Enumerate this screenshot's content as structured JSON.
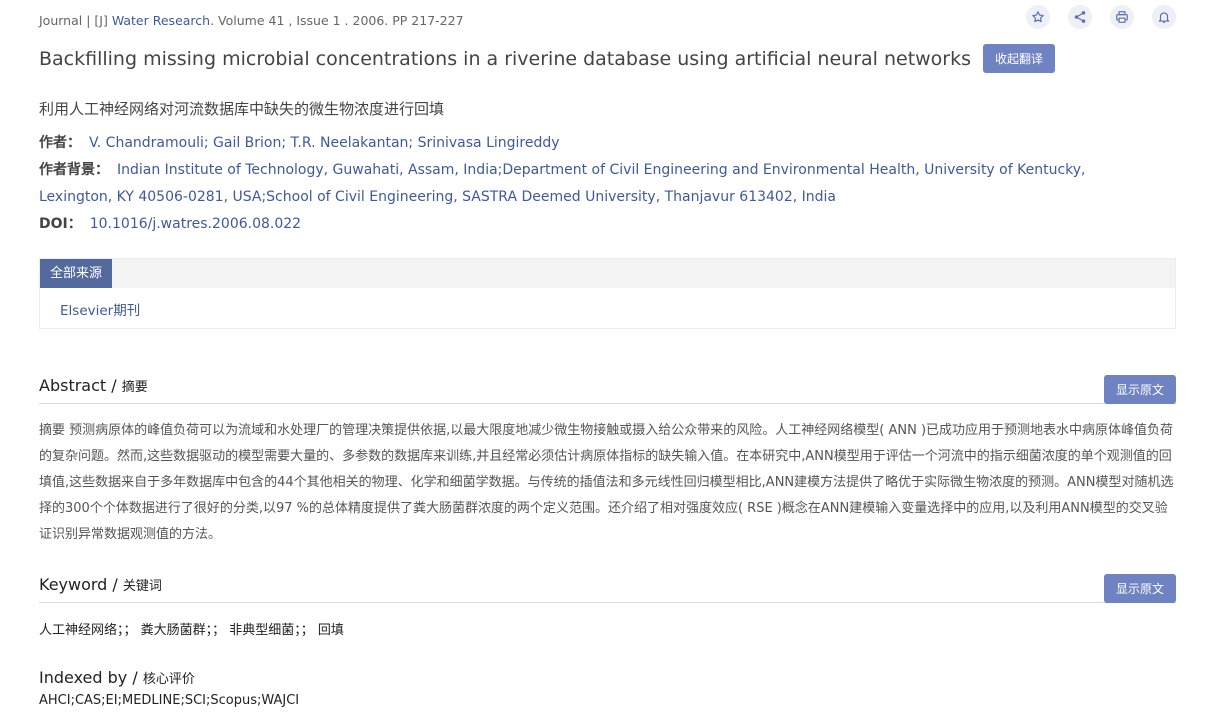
{
  "meta": {
    "prefix": "Journal | [J] ",
    "journal": "Water Research",
    "suffix": ". Volume 41 , Issue 1 . 2006. PP 217-227"
  },
  "actions": {
    "favorite_icon": "star-icon",
    "share_icon": "share-icon",
    "print_icon": "print-icon",
    "notify_icon": "bell-icon"
  },
  "title": "Backfilling missing microbial concentrations in a riverine database using artificial neural networks",
  "translate_button": "收起翻译",
  "cn_title": "利用人工神经网络对河流数据库中缺失的微生物浓度进行回填",
  "authors": {
    "label": "作者：",
    "value": "V. Chandramouli; Gail Brion; T.R. Neelakantan; Srinivasa Lingireddy"
  },
  "affiliation": {
    "label": "作者背景：",
    "value": "Indian Institute of Technology, Guwahati, Assam, India;Department of Civil Engineering and Environmental Health, University of Kentucky, Lexington, KY 40506-0281, USA;School of Civil Engineering, SASTRA Deemed University, Thanjavur 613402, India"
  },
  "doi": {
    "label": "DOI：",
    "value": "10.1016/j.watres.2006.08.022"
  },
  "sources": {
    "tab": "全部来源",
    "item": "Elsevier期刊"
  },
  "abstract": {
    "heading": "Abstract / ",
    "heading_sub": "摘要",
    "button": "显示原文",
    "text": "摘要 预测病原体的峰值负荷可以为流域和水处理厂的管理决策提供依据,以最大限度地减少微生物接触或摄入给公众带来的风险。人工神经网络模型( ANN )已成功应用于预测地表水中病原体峰值负荷的复杂问题。然而,这些数据驱动的模型需要大量的、多参数的数据库来训练,并且经常必须估计病原体指标的缺失输入值。在本研究中,ANN模型用于评估一个河流中的指示细菌浓度的单个观测值的回填值,这些数据来自于多年数据库中包含的44个其他相关的物理、化学和细菌学数据。与传统的插值法和多元线性回归模型相比,ANN建模方法提供了略优于实际微生物浓度的预测。ANN模型对随机选择的300个个体数据进行了很好的分类,以97 %的总体精度提供了粪大肠菌群浓度的两个定义范围。还介绍了相对强度效应( RSE )概念在ANN建模输入变量选择中的应用,以及利用ANN模型的交叉验证识别异常数据观测值的方法。"
  },
  "keyword": {
    "heading": "Keyword / ",
    "heading_sub": "关键词",
    "button": "显示原文",
    "text": "人工神经网络；；  粪大肠菌群；；  非典型细菌；；  回填"
  },
  "indexed": {
    "heading": "Indexed by / ",
    "heading_sub": "核心评价",
    "text": "AHCI;CAS;EI;MEDLINE;SCI;Scopus;WAJCI"
  },
  "colors": {
    "accent": "#6f83c2",
    "link": "#3d5a9e",
    "tab": "#546a9f"
  }
}
